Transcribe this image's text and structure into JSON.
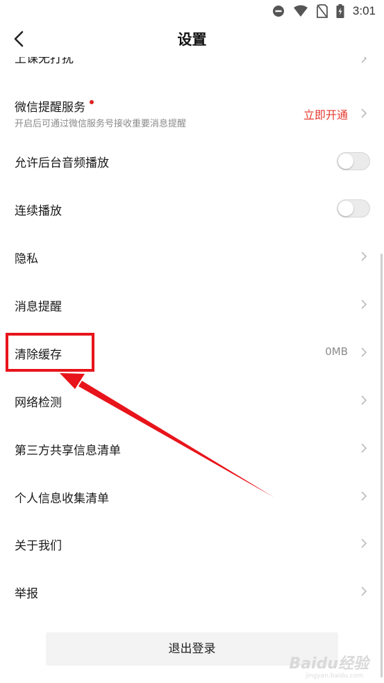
{
  "status_bar": {
    "time": "3:01",
    "icons": [
      "do-not-disturb-icon",
      "wifi-icon",
      "no-sim-icon",
      "battery-charging-icon"
    ]
  },
  "header": {
    "title": "设置"
  },
  "rows": {
    "partial_top": "上课无打扰",
    "wechat": {
      "label": "微信提醒服务",
      "sub": "开启后可通过微信服务号接收重要消息提醒",
      "action": "立即开通"
    },
    "background_audio": {
      "label": "允许后台音频播放",
      "enabled": false
    },
    "continuous_play": {
      "label": "连续播放",
      "enabled": false
    },
    "privacy": {
      "label": "隐私"
    },
    "notifications": {
      "label": "消息提醒"
    },
    "clear_cache": {
      "label": "清除缓存",
      "value": "0MB"
    },
    "network_check": {
      "label": "网络检测"
    },
    "third_party": {
      "label": "第三方共享信息清单"
    },
    "personal_info": {
      "label": "个人信息收集清单"
    },
    "about": {
      "label": "关于我们"
    },
    "report": {
      "label": "举报"
    }
  },
  "logout_label": "退出登录",
  "watermark": {
    "text": "Baidu经验",
    "sub": "jingyan.baidu.com"
  },
  "colors": {
    "accent_red": "#e8141b",
    "action_red": "#e53a2f",
    "muted_text": "#8a8a8a"
  }
}
